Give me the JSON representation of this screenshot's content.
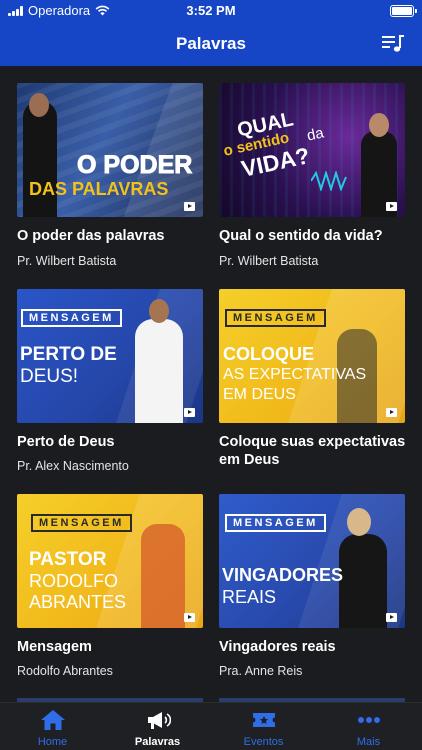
{
  "status_bar": {
    "carrier": "Operadora",
    "time": "3:52 PM"
  },
  "header": {
    "title": "Palavras"
  },
  "items": [
    {
      "title": "O poder das palavras",
      "speaker": "Pr. Wilbert Batista",
      "thumb_lines": [
        "O PODER",
        "DAS PALAVRAS"
      ]
    },
    {
      "title": "Qual o sentido da vida?",
      "speaker": "Pr. Wilbert Batista",
      "thumb_lines": [
        "QUAL",
        "o sentido",
        "da",
        "VIDA?"
      ]
    },
    {
      "title": "Perto de Deus",
      "speaker": "Pr. Alex Nascimento",
      "thumb_tag": "MENSAGEM",
      "thumb_lines": [
        "PERTO DE",
        "DEUS!"
      ]
    },
    {
      "title": "Coloque suas expectativas em Deus",
      "speaker": "",
      "thumb_tag": "MENSAGEM",
      "thumb_lines": [
        "COLOQUE",
        "AS EXPECTATIVAS",
        "EM DEUS"
      ]
    },
    {
      "title": "Mensagem",
      "speaker": "Rodolfo Abrantes",
      "thumb_tag": "MENSAGEM",
      "thumb_lines": [
        "PASTOR",
        "RODOLFO",
        "ABRANTES"
      ]
    },
    {
      "title": "Vingadores reais",
      "speaker": "Pra. Anne Reis",
      "thumb_tag": "MENSAGEM",
      "thumb_lines": [
        "VINGADORES",
        "REAIS"
      ]
    }
  ],
  "tabs": [
    {
      "label": "Home",
      "icon": "home-icon",
      "active": false
    },
    {
      "label": "Palavras",
      "icon": "megaphone-icon",
      "active": true
    },
    {
      "label": "Eventos",
      "icon": "ticket-icon",
      "active": false
    },
    {
      "label": "Mais",
      "icon": "more-dots-icon",
      "active": false
    }
  ],
  "colors": {
    "nav_blue": "#1646c6",
    "background": "#1b1c20",
    "tab_inactive": "#2f6ee8",
    "tab_active": "#ffffff",
    "thumb_yellow": "#f2c21b",
    "thumb_blue": "#2a4fc0"
  }
}
